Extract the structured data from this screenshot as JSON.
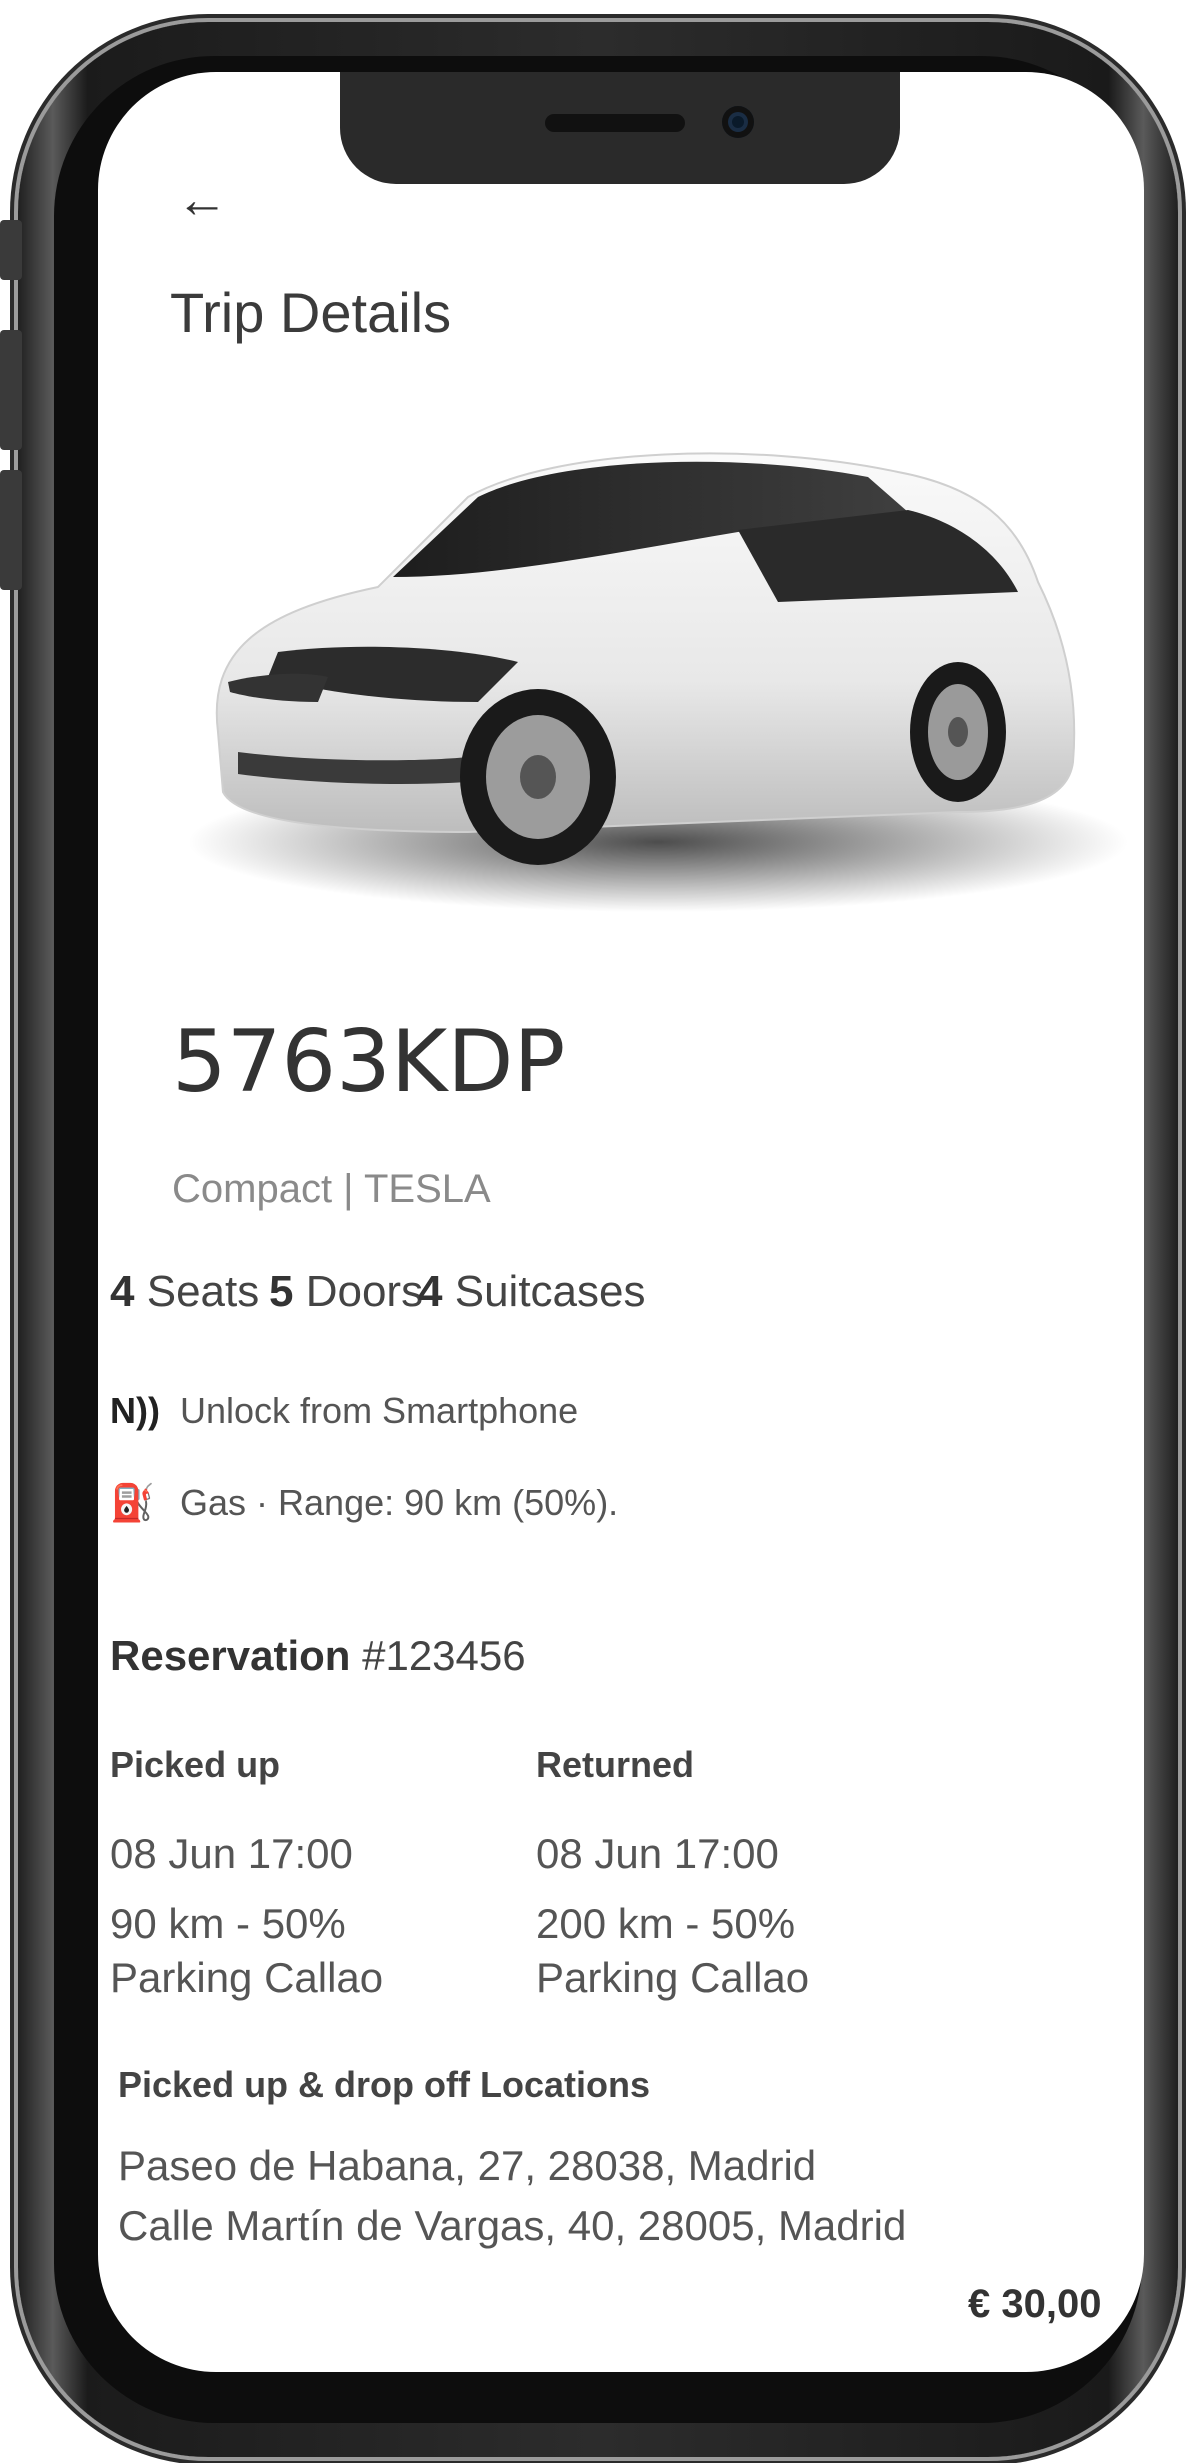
{
  "header": {
    "back_icon": "arrow-left-icon",
    "back_glyph": "←",
    "title": "Trip Details"
  },
  "vehicle": {
    "plate": "5763KDP",
    "class_brand": "Compact | TESLA",
    "seats": {
      "count": "4",
      "label": "Seats"
    },
    "doors": {
      "count": "5",
      "label": "Doors"
    },
    "suitcases": {
      "count": "4",
      "label": "Suitcases"
    }
  },
  "features": [
    {
      "icon": "nfc-icon",
      "glyph": "N))",
      "text": "Unlock from Smartphone"
    },
    {
      "icon": "fuel-pump-icon",
      "glyph": "⛽",
      "text": "Gas · Range: 90 km (50%)."
    }
  ],
  "reservation": {
    "label": "Reservation",
    "number": "#123456"
  },
  "picked_up": {
    "label": "Picked up",
    "datetime": "08 Jun 17:00",
    "km": "90 km - 50%",
    "location": "Parking Callao"
  },
  "returned": {
    "label": "Returned",
    "datetime": "08 Jun 17:00",
    "km": "200 km - 50%",
    "location": "Parking Callao"
  },
  "locations": {
    "label": "Picked up & drop off Locations",
    "pickup_address": "Paseo de Habana, 27, 28038, Madrid",
    "dropoff_address": "Calle Martín de Vargas, 40, 28005, Madrid"
  },
  "price": "€ 30,00"
}
